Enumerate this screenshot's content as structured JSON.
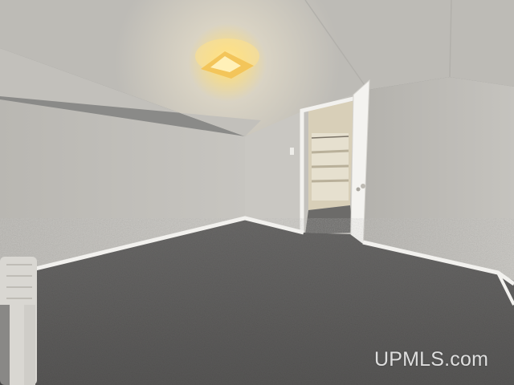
{
  "image": {
    "watermark": "UPMLS.com",
    "colors": {
      "ceiling": "#c9c7c2",
      "wall": "#c4c2bd",
      "carpet": "#5e5d5c",
      "trim": "#f2f1ee",
      "light_glow": "#ffd36a"
    }
  }
}
